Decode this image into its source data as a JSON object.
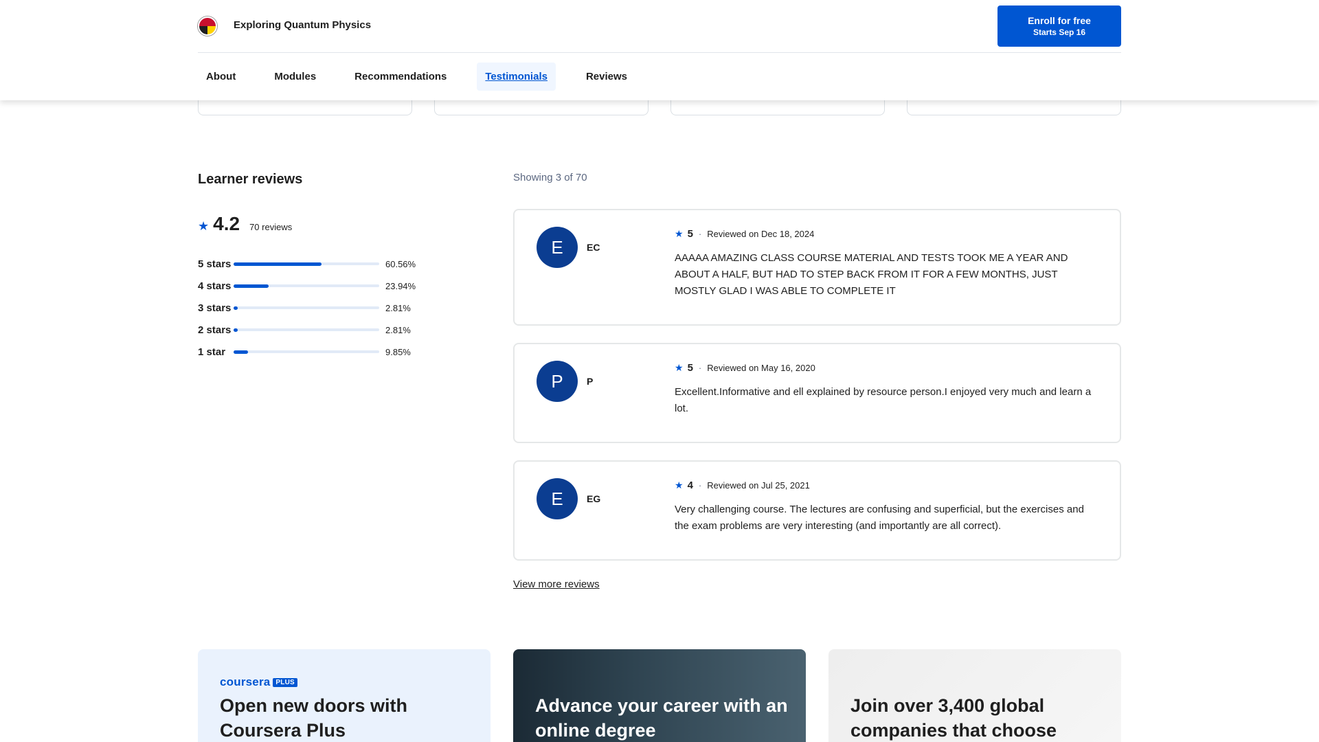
{
  "header": {
    "course_title": "Exploring Quantum Physics",
    "enroll": {
      "label": "Enroll for free",
      "sublabel": "Starts Sep 16"
    }
  },
  "nav": {
    "items": [
      {
        "label": "About"
      },
      {
        "label": "Modules"
      },
      {
        "label": "Recommendations"
      },
      {
        "label": "Testimonials",
        "active": true
      },
      {
        "label": "Reviews"
      }
    ]
  },
  "reviews": {
    "heading": "Learner reviews",
    "rating": "4.2",
    "count_text": "70 reviews",
    "distribution": [
      {
        "label": "5 stars",
        "percent": "60.56%",
        "fraction": 0.6056
      },
      {
        "label": "4 stars",
        "percent": "23.94%",
        "fraction": 0.2394
      },
      {
        "label": "3 stars",
        "percent": "2.81%",
        "fraction": 0.0281
      },
      {
        "label": "2 stars",
        "percent": "2.81%",
        "fraction": 0.0281
      },
      {
        "label": "1 star",
        "percent": "9.85%",
        "fraction": 0.0985
      }
    ],
    "showing": "Showing 3 of 70",
    "items": [
      {
        "avatar_letter": "E",
        "name": "EC",
        "rating": "5",
        "date": "Reviewed on Dec 18, 2024",
        "text": "AAAAA AMAZING CLASS COURSE MATERIAL AND TESTS TOOK ME A YEAR AND ABOUT A HALF, BUT HAD TO STEP BACK FROM IT FOR A FEW MONTHS, JUST MOSTLY GLAD I WAS ABLE TO COMPLETE IT"
      },
      {
        "avatar_letter": "P",
        "name": "P",
        "rating": "5",
        "date": "Reviewed on May 16, 2020",
        "text": "Excellent.Informative and ell explained by resource person.I enjoyed very much and learn a lot."
      },
      {
        "avatar_letter": "E",
        "name": "EG",
        "rating": "4",
        "date": "Reviewed on Jul 25, 2021",
        "text": "Very challenging course. The lectures are confusing and superficial, but the exercises and the exam problems are very interesting (and importantly are all correct)."
      }
    ],
    "view_more": "View more reviews"
  },
  "promos": [
    {
      "brand": "coursera",
      "brand_badge": "PLUS",
      "title": "Open new doors with Coursera Plus"
    },
    {
      "title": "Advance your career with an online degree"
    },
    {
      "title": "Join over 3,400 global companies that choose"
    }
  ],
  "colors": {
    "accent": "#0056d2",
    "avatar": "#0b3d91"
  }
}
